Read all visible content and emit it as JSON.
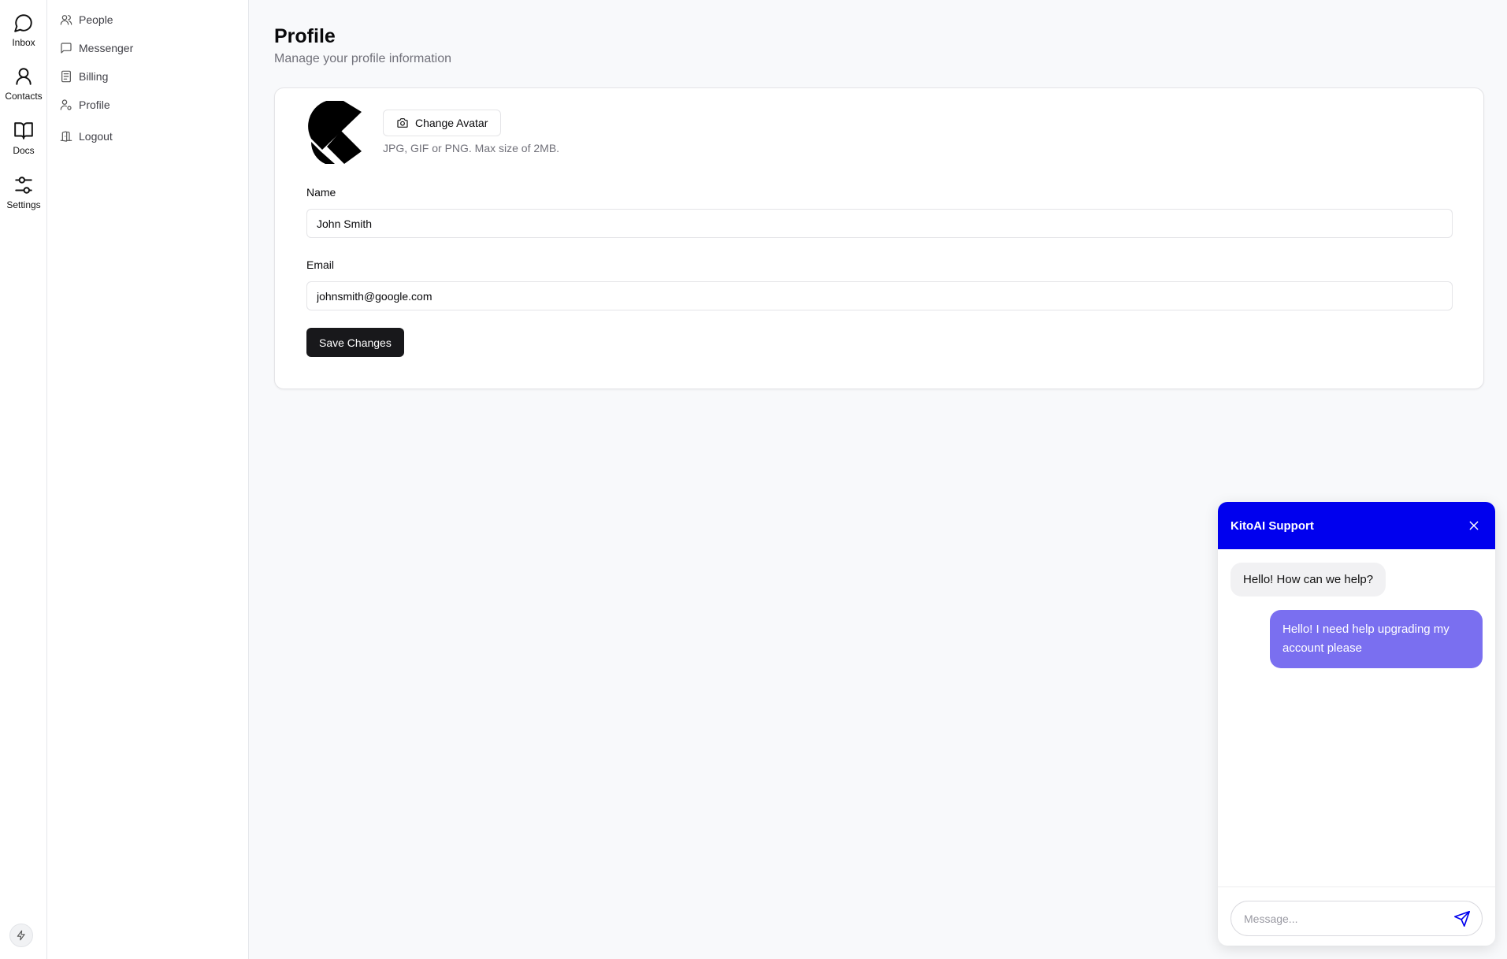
{
  "rail": {
    "items": [
      {
        "label": "Inbox",
        "icon": "message-circle-icon"
      },
      {
        "label": "Contacts",
        "icon": "user-icon"
      },
      {
        "label": "Docs",
        "icon": "book-open-icon"
      },
      {
        "label": "Settings",
        "icon": "sliders-icon"
      }
    ],
    "bottom_icon": "bolt-icon"
  },
  "subnav": {
    "items": [
      {
        "label": "People",
        "icon": "users-icon"
      },
      {
        "label": "Messenger",
        "icon": "message-square-icon"
      },
      {
        "label": "Billing",
        "icon": "receipt-icon"
      },
      {
        "label": "Profile",
        "icon": "user-cog-icon"
      },
      {
        "label": "Logout",
        "icon": "door-icon"
      }
    ]
  },
  "profile": {
    "title": "Profile",
    "subtitle": "Manage your profile information",
    "change_avatar_label": "Change Avatar",
    "avatar_hint": "JPG, GIF or PNG. Max size of 2MB.",
    "name_label": "Name",
    "name_value": "John Smith",
    "email_label": "Email",
    "email_value": "johnsmith@google.com",
    "save_label": "Save Changes"
  },
  "chat": {
    "title": "KitoAI Support",
    "accent_color": "#0000ee",
    "user_bubble_color": "#7a6ff0",
    "messages": [
      {
        "from": "bot",
        "text": "Hello! How can we help?"
      },
      {
        "from": "user",
        "text": "Hello! I need help upgrading my account please"
      }
    ],
    "input_placeholder": "Message..."
  }
}
